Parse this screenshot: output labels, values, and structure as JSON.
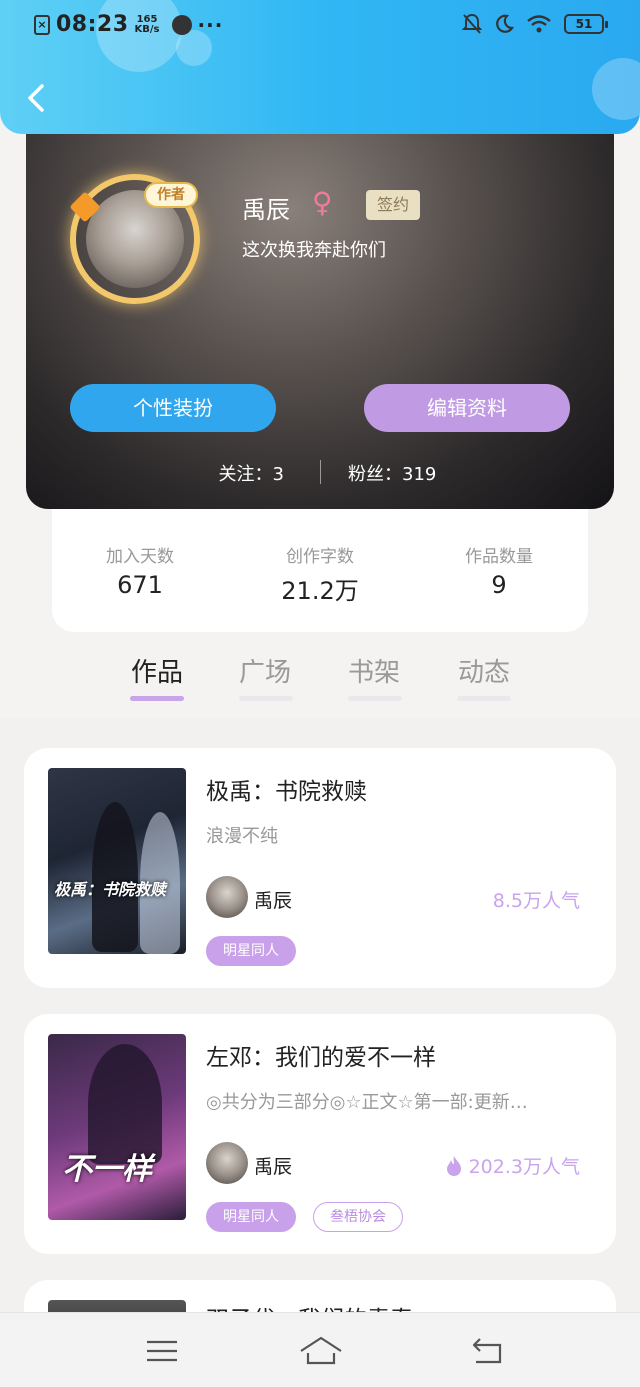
{
  "status_bar": {
    "time": "08:23",
    "speed_value": "165",
    "speed_unit": "KB/s",
    "dots": "···",
    "battery": "51"
  },
  "profile": {
    "author_badge": "作者",
    "name": "禹辰",
    "gender_symbol": "♀",
    "sign_badge": "签约",
    "bio": "这次换我奔赴你们",
    "dress_button": "个性装扮",
    "edit_button": "编辑资料",
    "follow": "关注：3",
    "fans": "粉丝：319"
  },
  "stats": [
    {
      "label": "加入天数",
      "value": "671"
    },
    {
      "label": "创作字数",
      "value": "21.2万"
    },
    {
      "label": "作品数量",
      "value": "9"
    }
  ],
  "tabs": [
    {
      "label": "作品",
      "active": true
    },
    {
      "label": "广场",
      "active": false
    },
    {
      "label": "书架",
      "active": false
    },
    {
      "label": "动态",
      "active": false
    }
  ],
  "books": [
    {
      "title": "极禹：书院救赎",
      "desc": "浪漫不纯",
      "cover_text": "极禹：书院救赎",
      "author": "禹辰",
      "popularity": "8.5万人气",
      "hot": false,
      "tags": [
        "明星同人"
      ]
    },
    {
      "title": "左邓：我们的爱不一样",
      "desc": "◎共分为三部分◎☆正文☆第一部:更新…",
      "cover_text": "不一样",
      "author": "禹辰",
      "popularity": "202.3万人气",
      "hot": true,
      "tags": [
        "明星同人",
        "叁梧协会"
      ]
    }
  ],
  "book3_title_peek": "双子代：我们的青春",
  "colors": {
    "topbar": "#31b7f4",
    "accent_blue": "#2fa6ee",
    "accent_purple": "#c09be4",
    "popularity": "#c9a4ec"
  },
  "icons": {
    "back": "chevron-left-icon",
    "menu": "menu-icon",
    "home": "home-icon",
    "return": "return-icon",
    "flame": "flame-icon"
  }
}
